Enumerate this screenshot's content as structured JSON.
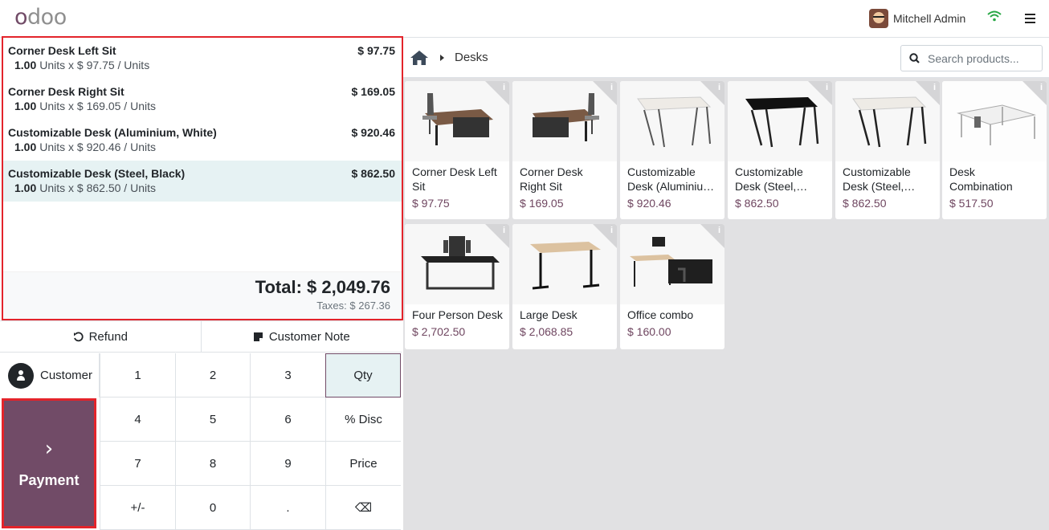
{
  "header": {
    "logo": "odoo",
    "user_name": "Mitchell Admin"
  },
  "order": {
    "lines": [
      {
        "name": "Corner Desk Left Sit",
        "price": "$ 97.75",
        "qty": "1.00",
        "detail": "Units x $ 97.75 / Units"
      },
      {
        "name": "Corner Desk Right Sit",
        "price": "$ 169.05",
        "qty": "1.00",
        "detail": "Units x $ 169.05 / Units"
      },
      {
        "name": "Customizable Desk (Aluminium, White)",
        "price": "$ 920.46",
        "qty": "1.00",
        "detail": "Units x $ 920.46 / Units"
      },
      {
        "name": "Customizable Desk (Steel, Black)",
        "price": "$ 862.50",
        "qty": "1.00",
        "detail": "Units x $ 862.50 / Units"
      }
    ],
    "total": "Total: $ 2,049.76",
    "taxes": "Taxes: $ 267.36"
  },
  "actions": {
    "refund": "Refund",
    "customer_note": "Customer Note"
  },
  "numpad": {
    "customer": "Customer",
    "payment": "Payment",
    "keys": [
      "1",
      "2",
      "3",
      "Qty",
      "4",
      "5",
      "6",
      "% Disc",
      "7",
      "8",
      "9",
      "Price",
      "+/-",
      "0",
      ".",
      "⌫"
    ]
  },
  "products": {
    "breadcrumb": "Desks",
    "search_placeholder": "Search products...",
    "items": [
      {
        "name": "Corner Desk Left Sit",
        "price": "$ 97.75"
      },
      {
        "name": "Corner Desk Right Sit",
        "price": "$ 169.05"
      },
      {
        "name": "Customizable Desk (Aluminiu…",
        "price": "$ 920.46"
      },
      {
        "name": "Customizable Desk (Steel,…",
        "price": "$ 862.50"
      },
      {
        "name": "Customizable Desk (Steel,…",
        "price": "$ 862.50"
      },
      {
        "name": "Desk Combination",
        "price": "$ 517.50"
      },
      {
        "name": "Four Person Desk",
        "price": "$ 2,702.50"
      },
      {
        "name": "Large Desk",
        "price": "$ 2,068.85"
      },
      {
        "name": "Office combo",
        "price": "$ 160.00"
      }
    ]
  },
  "colors": {
    "brand": "#714b67",
    "highlight": "#e3242b",
    "selected_row": "#e6f2f3"
  }
}
